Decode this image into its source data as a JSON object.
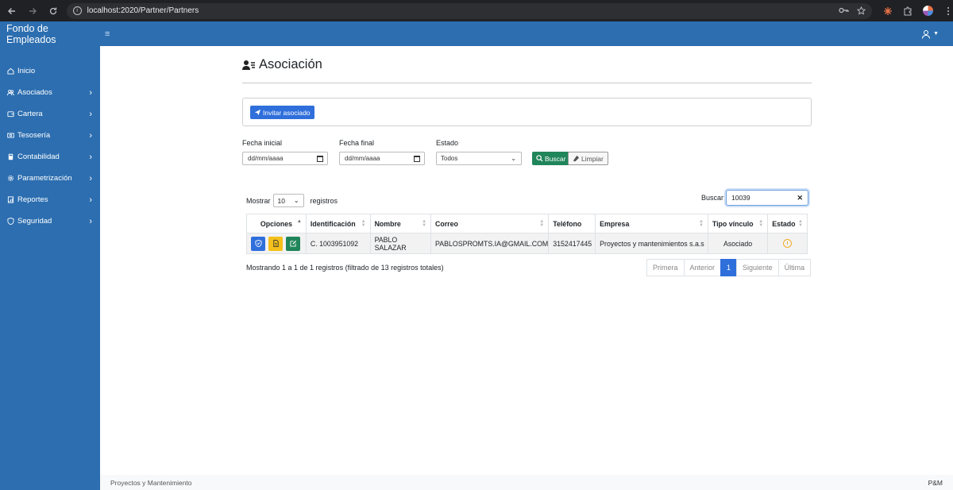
{
  "browser": {
    "url": "localhost:2020/Partner/Partners"
  },
  "header": {
    "app_title": "Fondo de Empleados"
  },
  "sidebar": {
    "items": [
      {
        "label": "Inicio",
        "icon": "home-icon",
        "has_children": false
      },
      {
        "label": "Asociados",
        "icon": "users-icon",
        "has_children": true
      },
      {
        "label": "Cartera",
        "icon": "wallet-icon",
        "has_children": true
      },
      {
        "label": "Tesosería",
        "icon": "cash-icon",
        "has_children": true
      },
      {
        "label": "Contabilidad",
        "icon": "calculator-icon",
        "has_children": true
      },
      {
        "label": "Parametrización",
        "icon": "gear-icon",
        "has_children": true
      },
      {
        "label": "Reportes",
        "icon": "report-icon",
        "has_children": true
      },
      {
        "label": "Seguridad",
        "icon": "shield-icon",
        "has_children": true
      }
    ]
  },
  "main": {
    "page_title": "Asociación",
    "invite_button": "Invitar asociado",
    "filters": {
      "start_label": "Fecha inicial",
      "start_value": "dd/mm/aaaa",
      "end_label": "Fecha final",
      "end_value": "dd/mm/aaaa",
      "status_label": "Estado",
      "status_value": "Todos",
      "search_button": "Buscar",
      "clear_button": "Limpiar"
    },
    "table_controls": {
      "show_label": "Mostrar",
      "page_length": "10",
      "records_label": "registros",
      "search_label": "Buscar:",
      "search_value": "10039"
    },
    "table": {
      "columns": [
        "Opciones",
        "Identificación",
        "Nombre",
        "Correo",
        "Teléfono",
        "Empresa",
        "Tipo vínculo",
        "Estado"
      ],
      "rows": [
        {
          "identificacion": "C. 1003951092",
          "nombre": "PABLO SALAZAR",
          "correo": "PABLOSPROMTS.IA@GMAIL.COM",
          "telefono": "3152417445",
          "empresa": "Proyectos y mantenimientos s.a.s",
          "tipo_vinculo": "Asociado",
          "estado_icon": "clock-icon"
        }
      ]
    },
    "info": "Mostrando 1 a 1 de 1 registros (filtrado de 13 registros totales)",
    "pagination": {
      "first": "Primera",
      "prev": "Anterior",
      "current": "1",
      "next": "Siguiente",
      "last": "Última"
    }
  },
  "footer": {
    "left": "Proyectos y Mantenimiento",
    "right": "P&M"
  },
  "colors": {
    "primary": "#2c6eb0",
    "button_blue": "#2f6fdb",
    "button_green": "#20855a",
    "button_yellow": "#f4c01a",
    "status_pending": "#f0ad2a"
  }
}
